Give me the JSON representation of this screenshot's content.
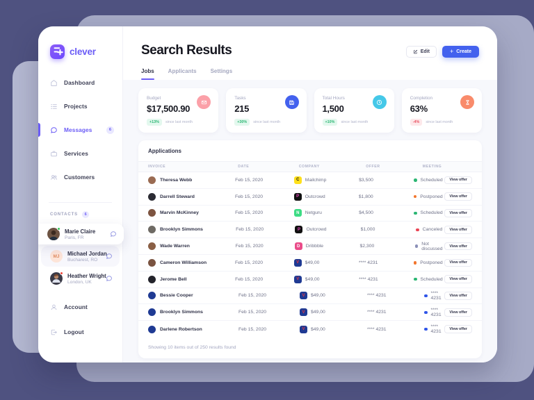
{
  "brand": {
    "name": "clever",
    "mark_icon": "sparkle-badge-icon"
  },
  "sidebar": {
    "nav": [
      {
        "label": "Dashboard",
        "icon": "home-icon",
        "badge": "",
        "active": false
      },
      {
        "label": "Projects",
        "icon": "list-icon",
        "badge": "",
        "active": false
      },
      {
        "label": "Messages",
        "icon": "chat-bubble-icon",
        "badge": "6",
        "active": true
      },
      {
        "label": "Services",
        "icon": "briefcase-icon",
        "badge": "",
        "active": false
      },
      {
        "label": "Customers",
        "icon": "users-icon",
        "badge": "",
        "active": false
      }
    ],
    "contacts_title": "CONTACTS",
    "contacts_count": "6",
    "contacts": [
      {
        "name": "Marie Claire",
        "location": "Paris, FR",
        "initials": "",
        "status_color": "#34c759",
        "style": "elevated"
      },
      {
        "name": "Michael Jordan",
        "location": "Bucharest, RO",
        "initials": "MJ",
        "status_color": "",
        "style": "tinted"
      },
      {
        "name": "Heather Wright",
        "location": "London, UK",
        "initials": "",
        "status_color": "#f04438",
        "style": "plain"
      }
    ],
    "footer": [
      {
        "label": "Account",
        "icon": "person-icon"
      },
      {
        "label": "Logout",
        "icon": "logout-icon"
      }
    ]
  },
  "header": {
    "title": "Search Results",
    "edit_label": "Edit",
    "edit_icon": "edit-square-icon",
    "create_label": "Create",
    "create_icon": "plus-icon",
    "tabs": [
      {
        "label": "Jobs",
        "active": true
      },
      {
        "label": "Applicants",
        "active": false
      },
      {
        "label": "Settings",
        "active": false
      }
    ]
  },
  "stats": [
    {
      "label": "Budget",
      "value": "$17,500.90",
      "delta": "+13%",
      "delta_dir": "up",
      "since": "since last month",
      "icon": "mail-icon",
      "icon_bg": "#fba0a8"
    },
    {
      "label": "Tasks",
      "value": "215",
      "delta": "+30%",
      "delta_dir": "up",
      "since": "since last month",
      "icon": "save-icon",
      "icon_bg": "#4361ee"
    },
    {
      "label": "Total Hours",
      "value": "1,500",
      "delta": "+10%",
      "delta_dir": "up",
      "since": "since last month",
      "icon": "clock-icon",
      "icon_bg": "#45c8e8"
    },
    {
      "label": "Completion",
      "value": "63%",
      "delta": "-4%",
      "delta_dir": "down",
      "since": "since last month",
      "icon": "hourglass-icon",
      "icon_bg": "#f98b6b"
    }
  ],
  "table": {
    "title": "Applications",
    "columns": [
      "INVOICE",
      "DATE",
      "COMPANY",
      "OFFER",
      "MEETING",
      ""
    ],
    "action_label": "View offer",
    "rows": [
      {
        "name": "Theresa Webb",
        "avatar": "#9a6b52",
        "date": "Feb 15, 2020",
        "company": "Mailchimp",
        "logo_bg": "#ffe01b",
        "logo_fg": "#111111",
        "logo_text": "C",
        "offer": "$3,500",
        "meeting": "Scheduled",
        "meeting_color": "#2bb673"
      },
      {
        "name": "Darrell Steward",
        "avatar": "#2b2b33",
        "date": "Feb 15, 2020",
        "company": "Outcrowd",
        "logo_bg": "#111111",
        "logo_fg": "#e94bc0",
        "logo_text": "P",
        "offer": "$1,800",
        "meeting": "Postponed",
        "meeting_color": "#f2762e"
      },
      {
        "name": "Marvin McKinney",
        "avatar": "#7d5440",
        "date": "Feb 15, 2020",
        "company": "Netguru",
        "logo_bg": "#3ddc84",
        "logo_fg": "#ffffff",
        "logo_text": "N",
        "offer": "$4,500",
        "meeting": "Scheduled",
        "meeting_color": "#2bb673"
      },
      {
        "name": "Brooklyn Simmons",
        "avatar": "#6e6a64",
        "date": "Feb 15, 2020",
        "company": "Outcrowd",
        "logo_bg": "#111111",
        "logo_fg": "#e94bc0",
        "logo_text": "P",
        "offer": "$1,000",
        "meeting": "Canceled",
        "meeting_color": "#ea4455"
      },
      {
        "name": "Wade Warren",
        "avatar": "#8a5f45",
        "date": "Feb 15, 2020",
        "company": "Dribbble",
        "logo_bg": "#ea4c89",
        "logo_fg": "#ffffff",
        "logo_text": "D",
        "offer": "$2,300",
        "meeting": "Not discussed",
        "meeting_color": "#8b90b8"
      },
      {
        "name": "Cameron Williamson",
        "avatar": "#7a5340",
        "date": "Feb 15, 2020",
        "company": "$49,00",
        "logo_bg": "#1f3a93",
        "logo_fg": "#e63946",
        "logo_text": "V",
        "offer": "**** 4231",
        "meeting": "Postponed",
        "meeting_color": "#f2762e"
      },
      {
        "name": "Jerome Bell",
        "avatar": "#23232b",
        "date": "Feb 15, 2020",
        "company": "$49,00",
        "logo_bg": "#1f3a93",
        "logo_fg": "#e63946",
        "logo_text": "V",
        "offer": "**** 4231",
        "meeting": "Scheduled",
        "meeting_color": "#2bb673"
      },
      {
        "name": "Bessie Cooper",
        "avatar": "#1f3a93",
        "date": "Feb 15, 2020",
        "company": "$49,00",
        "logo_bg": "#1f3a93",
        "logo_fg": "#e63946",
        "logo_text": "V",
        "offer": "**** 4231",
        "meeting": "**** 4231",
        "meeting_color": "#2f55e8"
      },
      {
        "name": "Brooklyn Simmons",
        "avatar": "#1f3a93",
        "date": "Feb 15, 2020",
        "company": "$49,00",
        "logo_bg": "#1f3a93",
        "logo_fg": "#e63946",
        "logo_text": "V",
        "offer": "**** 4231",
        "meeting": "**** 4231",
        "meeting_color": "#2f55e8"
      },
      {
        "name": "Darlene Robertson",
        "avatar": "#1f3a93",
        "date": "Feb 15, 2020",
        "company": "$49,00",
        "logo_bg": "#1f3a93",
        "logo_fg": "#e63946",
        "logo_text": "V",
        "offer": "**** 4231",
        "meeting": "**** 4231",
        "meeting_color": "#2f55e8"
      }
    ],
    "footer_text": "Showing 10 items out of 250 results found"
  },
  "theme": {
    "page_bg": "#4f5280",
    "accent": "#6b5cf6",
    "create_blue": "#4361ee"
  }
}
